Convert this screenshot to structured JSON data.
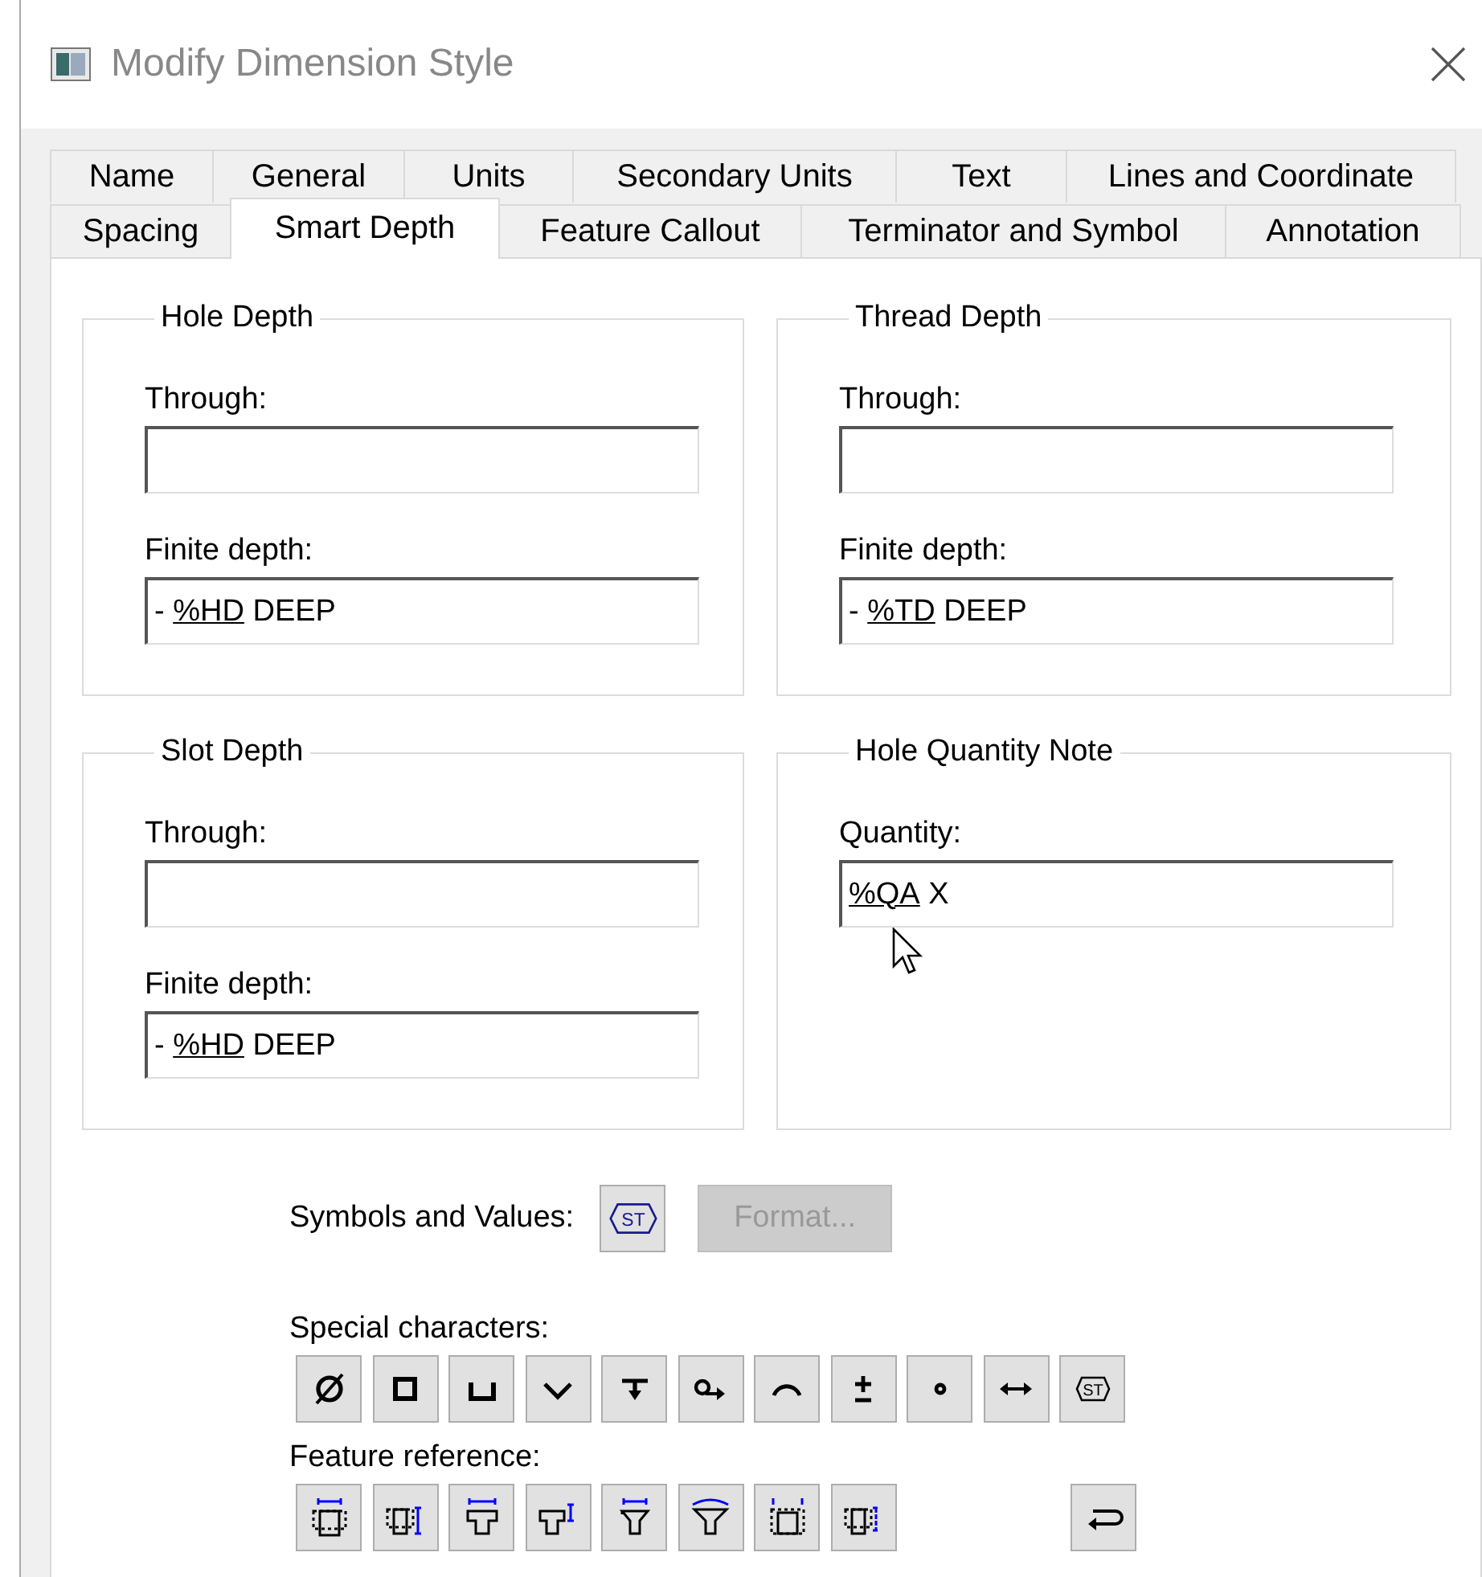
{
  "window": {
    "title": "Modify Dimension Style"
  },
  "tab_rows": [
    {
      "tabs": [
        {
          "label": "Name",
          "selected": false
        },
        {
          "label": "General",
          "selected": false
        },
        {
          "label": "Units",
          "selected": false
        },
        {
          "label": "Secondary Units",
          "selected": false
        },
        {
          "label": "Text",
          "selected": false
        },
        {
          "label": "Lines and Coordinate",
          "selected": false
        }
      ]
    },
    {
      "tabs": [
        {
          "label": "Spacing",
          "selected": false
        },
        {
          "label": "Smart Depth",
          "selected": true
        },
        {
          "label": "Feature Callout",
          "selected": false
        },
        {
          "label": "Terminator and Symbol",
          "selected": false
        },
        {
          "label": "Annotation",
          "selected": false
        }
      ]
    }
  ],
  "groups": [
    {
      "title": "Hole Depth",
      "fields": [
        {
          "label": "Through:"
        },
        {
          "label": "Finite depth:",
          "value_prefix": "- ",
          "value_token": "%HD",
          "value_suffix": " DEEP"
        }
      ]
    },
    {
      "title": "Thread Depth",
      "fields": [
        {
          "label": "Through:"
        },
        {
          "label": "Finite depth:",
          "value_prefix": "- ",
          "value_token": "%TD",
          "value_suffix": " DEEP"
        }
      ]
    },
    {
      "title": "Slot Depth",
      "fields": [
        {
          "label": "Through:"
        },
        {
          "label": "Finite depth:",
          "value_prefix": "- ",
          "value_token": "%HD",
          "value_suffix": " DEEP"
        }
      ]
    },
    {
      "title": "Hole Quantity Note",
      "fields": [
        {
          "label": "Quantity:",
          "value_token": "%QA",
          "value_suffix": " X"
        }
      ]
    }
  ],
  "symbols": {
    "label": "Symbols and Values:",
    "symbol_button": "ST",
    "format_button": {
      "label": "Format...",
      "disabled": true
    }
  },
  "special_characters": {
    "label": "Special characters:",
    "buttons": [
      {
        "kind": "diameter"
      },
      {
        "kind": "square"
      },
      {
        "kind": "counterbore"
      },
      {
        "kind": "countersink"
      },
      {
        "kind": "depth"
      },
      {
        "kind": "circlearrow"
      },
      {
        "kind": "arc"
      },
      {
        "kind": "plusminus"
      },
      {
        "kind": "degree"
      },
      {
        "kind": "doublearrow"
      },
      {
        "kind": "symbol",
        "text": "ST"
      }
    ]
  },
  "feature_reference": {
    "label": "Feature reference:",
    "buttons": [
      {
        "kind": "holewidth"
      },
      {
        "kind": "holedepth"
      },
      {
        "kind": "cborewidth"
      },
      {
        "kind": "cboredepth"
      },
      {
        "kind": "csinkwidth"
      },
      {
        "kind": "csinkangle"
      },
      {
        "kind": "threadwidth"
      },
      {
        "kind": "threaddepth"
      },
      {
        "kind": "return"
      }
    ]
  }
}
